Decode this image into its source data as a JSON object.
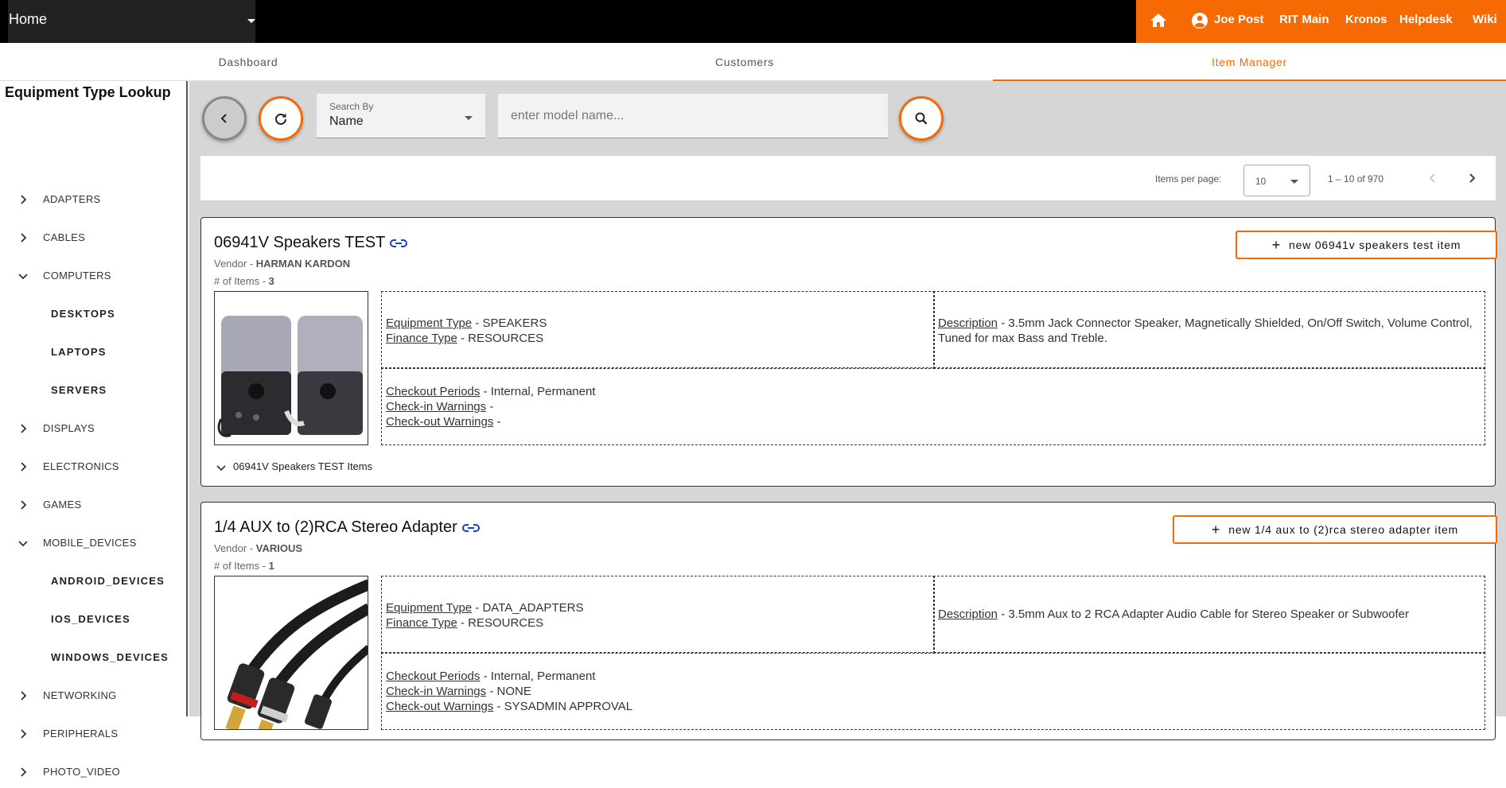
{
  "topbar": {
    "home_select": "Home",
    "nav": {
      "user": "Joe Post",
      "rit_main": "RIT Main",
      "kronos": "Kronos",
      "helpdesk": "Helpdesk",
      "wiki": "Wiki"
    },
    "accent": "#F76902"
  },
  "tabs": [
    {
      "label": "Dashboard"
    },
    {
      "label": "Customers"
    },
    {
      "label": "Item Manager",
      "active": true
    }
  ],
  "sidebar": {
    "title": "Equipment Type Lookup",
    "items": [
      {
        "label": "ADAPTERS",
        "state": "collapsed"
      },
      {
        "label": "CABLES",
        "state": "collapsed"
      },
      {
        "label": "COMPUTERS",
        "state": "expanded"
      },
      {
        "label": "DESKTOPS",
        "child": true
      },
      {
        "label": "LAPTOPS",
        "child": true
      },
      {
        "label": "SERVERS",
        "child": true
      },
      {
        "label": "DISPLAYS",
        "state": "collapsed"
      },
      {
        "label": "ELECTRONICS",
        "state": "collapsed"
      },
      {
        "label": "GAMES",
        "state": "collapsed"
      },
      {
        "label": "MOBILE_DEVICES",
        "state": "expanded"
      },
      {
        "label": "ANDROID_DEVICES",
        "child": true
      },
      {
        "label": "IOS_DEVICES",
        "child": true
      },
      {
        "label": "WINDOWS_DEVICES",
        "child": true
      },
      {
        "label": "NETWORKING",
        "state": "collapsed"
      },
      {
        "label": "PERIPHERALS",
        "state": "collapsed"
      },
      {
        "label": "PHOTO_VIDEO",
        "state": "collapsed"
      }
    ]
  },
  "search": {
    "search_by_label": "Search By",
    "search_by_value": "Name",
    "placeholder": "enter model name..."
  },
  "paginator": {
    "items_per_page_label": "Items per page:",
    "items_per_page": "10",
    "range": "1 – 10 of 970"
  },
  "cards": [
    {
      "title": "06941V Speakers TEST",
      "vendor_label": "Vendor - ",
      "vendor": "HARMAN KARDON",
      "count_label": "# of Items - ",
      "count": "3",
      "new_button": "new 06941v speakers test item",
      "equipment_type_label": "Equipment Type",
      "equipment_type": " - SPEAKERS",
      "finance_type_label": "Finance Type",
      "finance_type": " - RESOURCES",
      "description_label": "Description",
      "description": " - 3.5mm Jack Connector Speaker, Magnetically Shielded, On/Off Switch, Volume Control, Tuned for max Bass and Treble.",
      "checkout_periods_label": "Checkout Periods",
      "checkout_periods": " - Internal, Permanent",
      "checkin_warnings_label": "Check-in Warnings",
      "checkin_warnings": " -",
      "checkout_warnings_label": "Check-out Warnings",
      "checkout_warnings": " -",
      "items_expander": "06941V Speakers TEST Items"
    },
    {
      "title": "1/4 AUX to (2)RCA Stereo Adapter",
      "vendor_label": "Vendor - ",
      "vendor": "VARIOUS",
      "count_label": "# of Items - ",
      "count": "1",
      "new_button": "new 1/4 aux to (2)rca stereo adapter item",
      "equipment_type_label": "Equipment Type",
      "equipment_type": " - DATA_ADAPTERS",
      "finance_type_label": "Finance Type",
      "finance_type": " - RESOURCES",
      "description_label": "Description",
      "description": " - 3.5mm Aux to 2 RCA Adapter Audio Cable for Stereo Speaker or Subwoofer",
      "checkout_periods_label": "Checkout Periods",
      "checkout_periods": " - Internal, Permanent",
      "checkin_warnings_label": "Check-in Warnings",
      "checkin_warnings": " - NONE",
      "checkout_warnings_label": "Check-out Warnings",
      "checkout_warnings": " - SYSADMIN APPROVAL"
    }
  ]
}
